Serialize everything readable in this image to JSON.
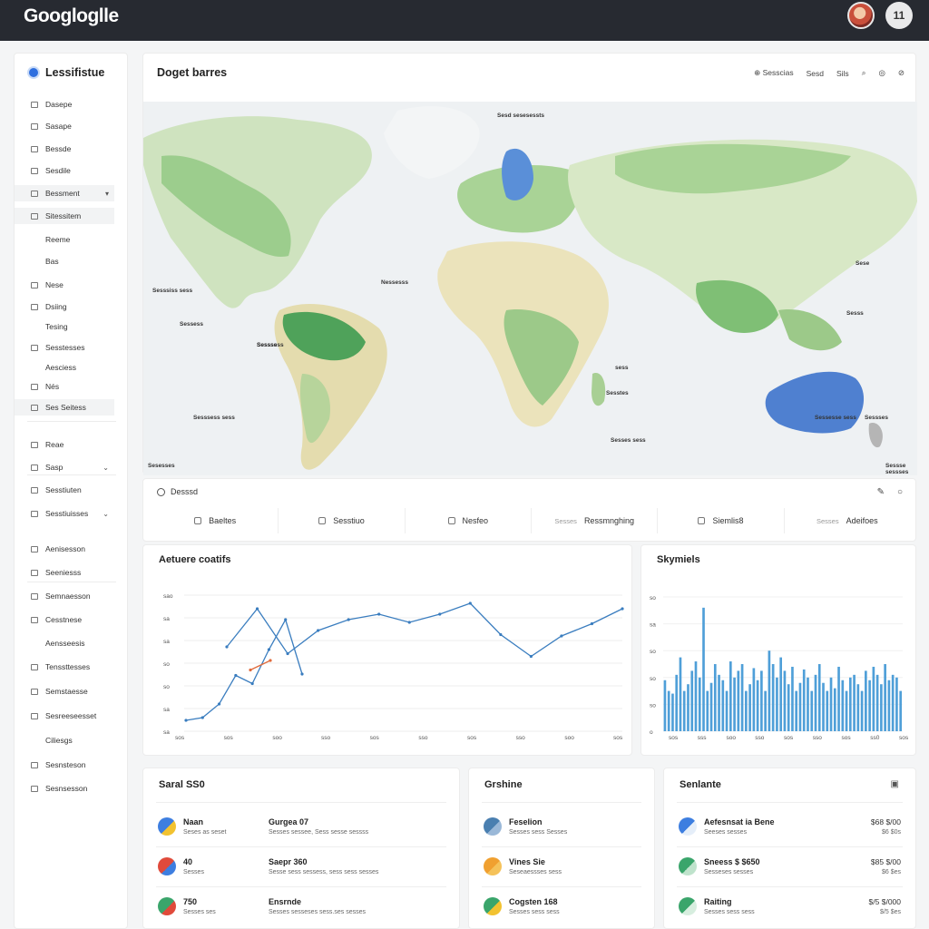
{
  "app": {
    "logo": "Googloglle",
    "avatar_text": "11"
  },
  "sidebar": {
    "header": "Lessifistue",
    "items": [
      {
        "label": "Dasepe",
        "icon": true,
        "sub": false,
        "chev": ""
      },
      {
        "label": "Sasape",
        "icon": true,
        "sub": false,
        "chev": ""
      },
      {
        "label": "Bessde",
        "icon": true,
        "sub": false,
        "chev": ""
      },
      {
        "label": "Sesdile",
        "icon": true,
        "sub": false,
        "chev": ""
      },
      {
        "label": "Bessment",
        "icon": true,
        "sub": false,
        "chev": "▾",
        "hl": true
      },
      {
        "label": "Sitessitem",
        "icon": true,
        "sub": false,
        "chev": "",
        "hl": true
      },
      {
        "label": "Reeme",
        "icon": false,
        "sub": true,
        "chev": ""
      },
      {
        "label": "Bas",
        "icon": false,
        "sub": true,
        "chev": ""
      },
      {
        "label": "Nese",
        "icon": true,
        "sub": false,
        "chev": ""
      },
      {
        "label": "Dsiing",
        "icon": true,
        "sub": false,
        "chev": ""
      },
      {
        "label": "Tesing",
        "icon": false,
        "sub": true,
        "chev": ""
      },
      {
        "label": "Sesstesses",
        "icon": true,
        "sub": false,
        "chev": ""
      },
      {
        "label": "Aesciess",
        "icon": false,
        "sub": true,
        "chev": ""
      },
      {
        "label": "Nés",
        "icon": true,
        "sub": false,
        "chev": ""
      },
      {
        "label": "Ses Seitess",
        "icon": true,
        "sub": false,
        "chev": "",
        "hl": true
      },
      {
        "label": "Reae",
        "icon": true,
        "sub": false,
        "chev": ""
      },
      {
        "label": "Sasp",
        "icon": true,
        "sub": false,
        "chev": "⌄"
      },
      {
        "label": "Sesstiuten",
        "icon": true,
        "sub": false,
        "chev": ""
      },
      {
        "label": "Sesstiuisses",
        "icon": true,
        "sub": false,
        "chev": "⌄"
      },
      {
        "label": "Aenisesson",
        "icon": true,
        "sub": false,
        "chev": ""
      },
      {
        "label": "Seeniesss",
        "icon": true,
        "sub": false,
        "chev": ""
      },
      {
        "label": "Semnaesson",
        "icon": true,
        "sub": false,
        "chev": ""
      },
      {
        "label": "Cesstnese",
        "icon": true,
        "sub": false,
        "chev": ""
      },
      {
        "label": "Aensseesis",
        "icon": false,
        "sub": true,
        "chev": ""
      },
      {
        "label": "Tenssttesses",
        "icon": true,
        "sub": false,
        "chev": ""
      },
      {
        "label": "Semstaesse",
        "icon": true,
        "sub": false,
        "chev": ""
      },
      {
        "label": "Sesreeseesset",
        "icon": true,
        "sub": false,
        "chev": ""
      },
      {
        "label": "Ciliesgs",
        "icon": false,
        "sub": true,
        "chev": ""
      },
      {
        "label": "Sesnsteson",
        "icon": true,
        "sub": false,
        "chev": ""
      },
      {
        "label": "Sesnsesson",
        "icon": true,
        "sub": false,
        "chev": ""
      }
    ]
  },
  "map_panel": {
    "title": "Doget barres",
    "tools": [
      "Sesscias",
      "Sesd",
      "Sils"
    ],
    "labels": [
      "Sesd sesesessts",
      "Sesssiss sess",
      "Nessesss",
      "Sessess",
      "Sessss",
      "Sesssess sess",
      "Sesesses",
      "sess",
      "Sesstes",
      "Sesses sess",
      "Sese",
      "Sesss",
      "Sessesse sess",
      "Sessses",
      "Sessse sessses",
      "Sesssess"
    ]
  },
  "filter_bar": {
    "search_label": "Desssd",
    "chips": [
      {
        "pre": "",
        "label": "Baeltes",
        "cb": true
      },
      {
        "pre": "",
        "label": "Sesstiuo",
        "cb": true
      },
      {
        "pre": "",
        "label": "Nesfeo",
        "cb": true
      },
      {
        "pre": "Sesses",
        "label": "Ressmnghing",
        "cb": false
      },
      {
        "pre": "",
        "label": "Siemlis8",
        "cb": true
      },
      {
        "pre": "Sesses",
        "label": "Adeifoes",
        "cb": false
      }
    ]
  },
  "line_chart": {
    "title": "Aetuere coatifs",
    "chart_data": {
      "type": "line",
      "yticks": [
        "sao",
        "sa",
        "sa",
        "so",
        "so",
        "sa",
        "sa"
      ],
      "xticks": [
        "sos",
        "sos",
        "soo",
        "sso",
        "sos",
        "sso",
        "sos",
        "sso",
        "soo",
        "sos"
      ],
      "series": [
        {
          "color": "#3a7dbf",
          "values": [
            0.62,
            0.9,
            0.57,
            0.74,
            0.82,
            0.86,
            0.8,
            0.86,
            0.94,
            0.71,
            0.55,
            0.7,
            0.79,
            0.9
          ]
        },
        {
          "color": "#3a7dbf",
          "values": [
            0.08,
            0.1,
            0.2,
            0.41,
            0.35,
            0.6,
            0.82,
            0.42
          ]
        },
        {
          "color": "#e06a3b",
          "values": [
            0.45,
            0.52
          ]
        }
      ]
    }
  },
  "bar_chart": {
    "title": "Skymiels",
    "chart_data": {
      "type": "bar",
      "yticks": [
        "so",
        "sa",
        "so",
        "so",
        "so",
        "o"
      ],
      "xticks": [
        "sos",
        "sss",
        "soo",
        "sso",
        "sos",
        "sso",
        "sos",
        "ss0",
        "sos"
      ],
      "values": [
        0.38,
        0.3,
        0.28,
        0.42,
        0.55,
        0.3,
        0.35,
        0.45,
        0.52,
        0.4,
        0.92,
        0.3,
        0.36,
        0.5,
        0.42,
        0.38,
        0.3,
        0.52,
        0.4,
        0.45,
        0.5,
        0.3,
        0.35,
        0.47,
        0.38,
        0.45,
        0.3,
        0.6,
        0.5,
        0.4,
        0.55,
        0.45,
        0.35,
        0.48,
        0.3,
        0.36,
        0.46,
        0.4,
        0.3,
        0.42,
        0.5,
        0.36,
        0.3,
        0.4,
        0.32,
        0.48,
        0.38,
        0.3,
        0.4,
        0.42,
        0.35,
        0.3,
        0.45,
        0.38,
        0.48,
        0.42,
        0.35,
        0.5,
        0.38,
        0.42,
        0.4,
        0.3
      ]
    }
  },
  "cards": [
    {
      "title": "Saral SS0",
      "rows": [
        {
          "icon_colors": [
            "#3d7ee0",
            "#f2c230"
          ],
          "t": "Naan",
          "s": "Seses as seset",
          "t2": "Gurgea 07",
          "s2": "Sesses sessee, Sess sesse sessss",
          "v": "",
          "v2": ""
        },
        {
          "icon_colors": [
            "#e04a3b",
            "#3d7ee0"
          ],
          "t": "40",
          "s": "Sesses",
          "t2": "Saepr 360",
          "s2": "Sesse sess sessess, sess sess sesses",
          "v": "",
          "v2": ""
        },
        {
          "icon_colors": [
            "#3aa56b",
            "#e04a3b"
          ],
          "t": "750",
          "s": "Sesses ses",
          "t2": "Ensrnde",
          "s2": "Sesses sesseses sess.ses sesses",
          "v": "",
          "v2": ""
        }
      ]
    },
    {
      "title": "Grshine",
      "rows": [
        {
          "icon_colors": [
            "#4a7fb0",
            "#9ab8d8"
          ],
          "t": "Feselion",
          "s": "Sesses sess Sesses",
          "v": "",
          "v2": ""
        },
        {
          "icon_colors": [
            "#f0a030",
            "#f5c25a"
          ],
          "t": "Vines Sie",
          "s": "Seseaessses sess",
          "v": "",
          "v2": ""
        },
        {
          "icon_colors": [
            "#3aa56b",
            "#f2c230"
          ],
          "t": "Cogsten 168",
          "s": "Sesses sess sess",
          "v": "",
          "v2": ""
        }
      ]
    },
    {
      "title": "Senlante",
      "rows": [
        {
          "icon_colors": [
            "#3d7ee0",
            "#e5eef9"
          ],
          "t": "Aefesnsat ia Bene",
          "s": "Seeses sesses",
          "v": "$68 $/00",
          "v2": "$6 $0s"
        },
        {
          "icon_colors": [
            "#3aa56b",
            "#bfe3cc"
          ],
          "t": "Sneess $ $650",
          "s": "Sesseses sesses",
          "v": "$85 $/00",
          "v2": "$6 $es"
        },
        {
          "icon_colors": [
            "#3aa56b",
            "#d7eedf"
          ],
          "t": "Raiting",
          "s": "Sesses sess sess",
          "v": "$/5 $/000",
          "v2": "$/5 $es"
        }
      ]
    }
  ]
}
